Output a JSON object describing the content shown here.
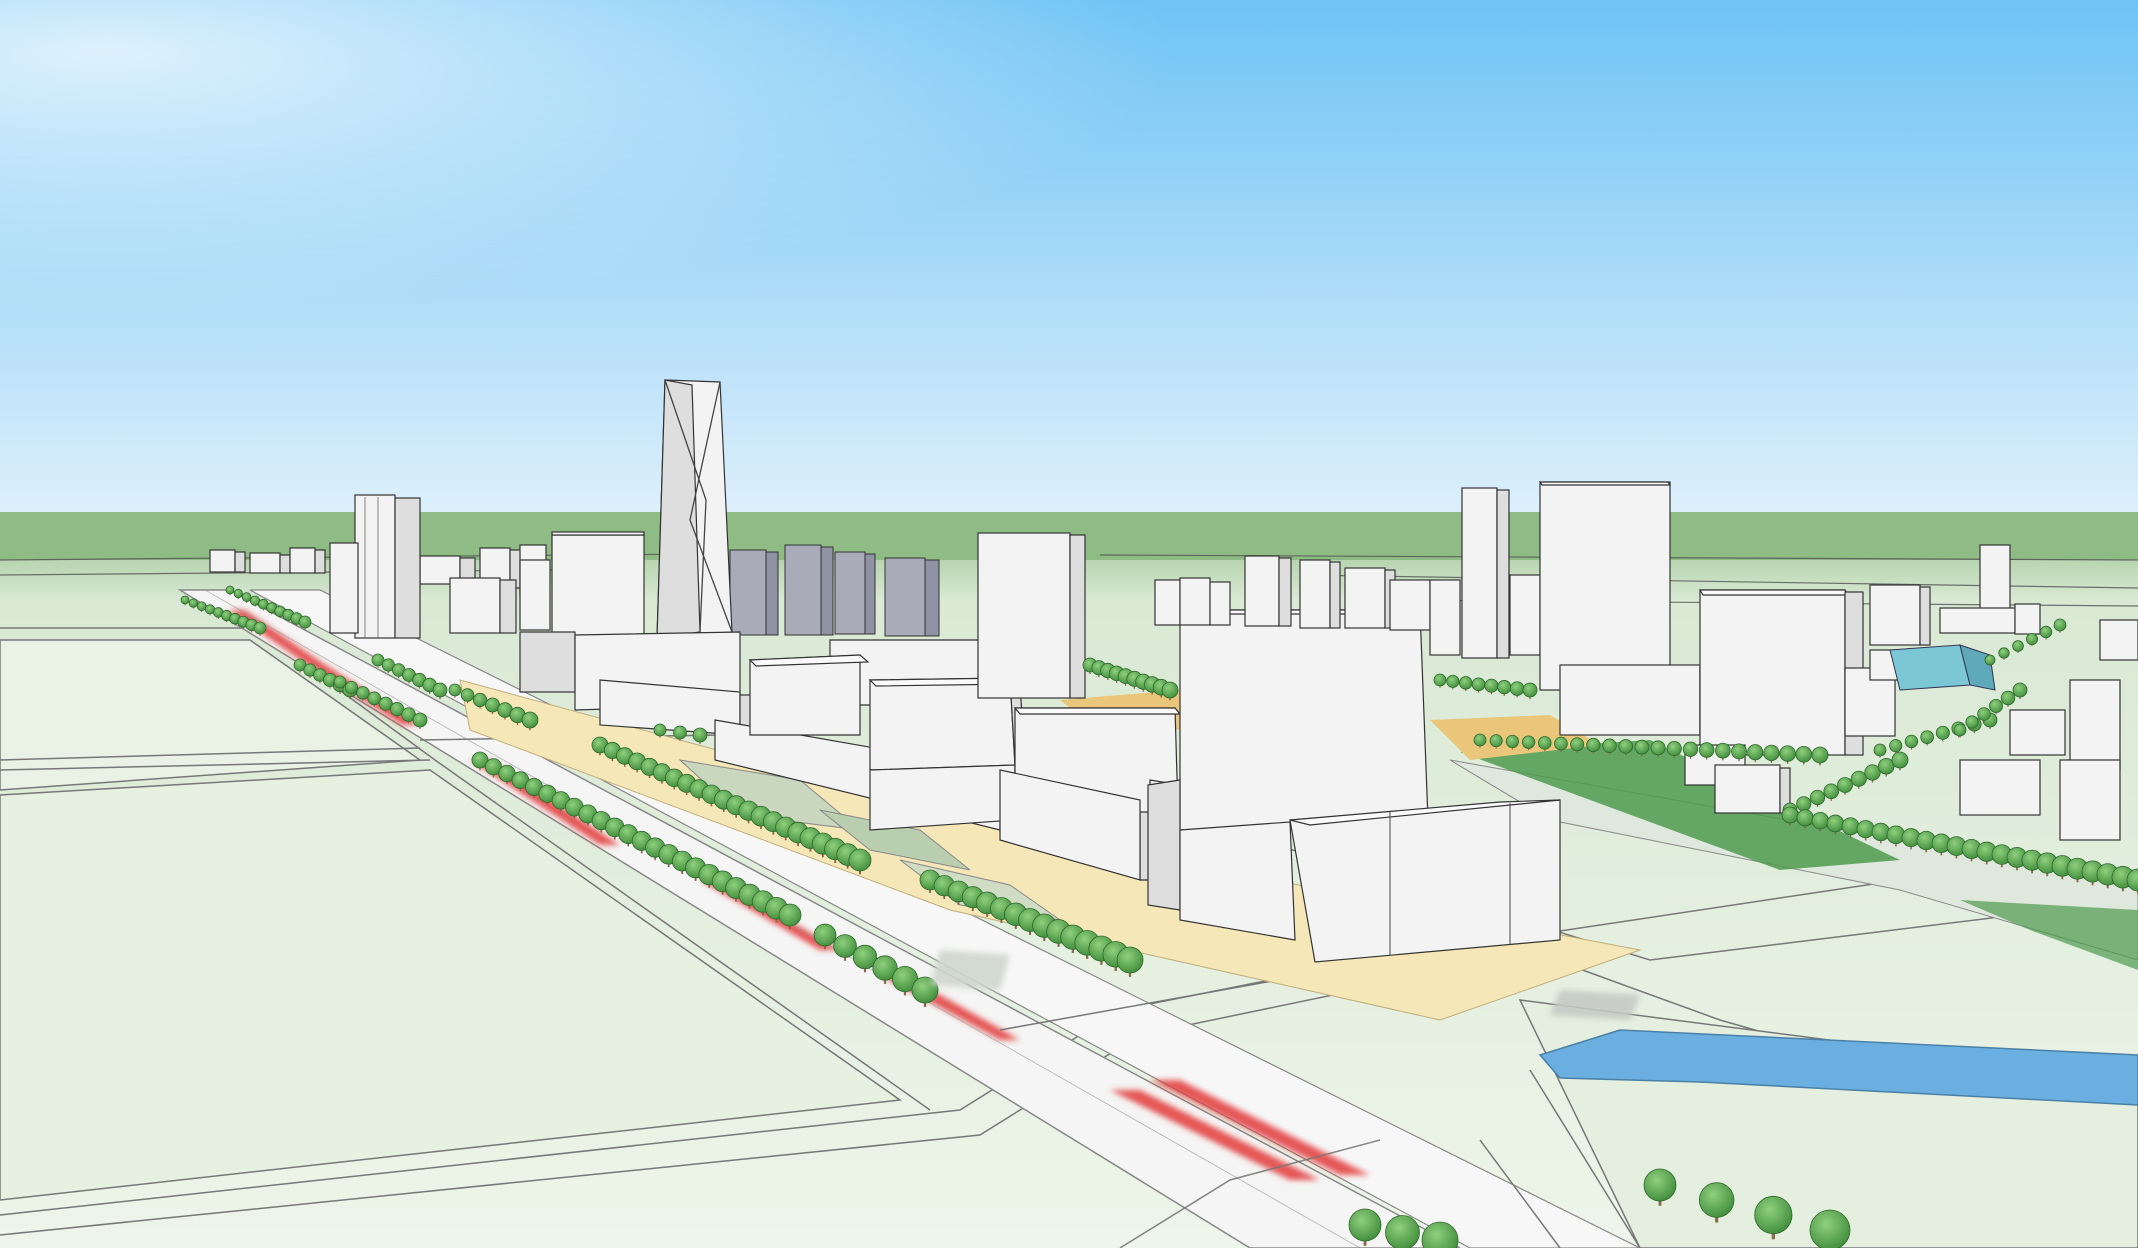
{
  "scene": {
    "kind": "3d-urban-massing-render",
    "colors": {
      "sky_top": "#6ec3f5",
      "sky_horizon": "#dff0fb",
      "ground_far": "#8fbc85",
      "ground_mid": "#d9e9d4",
      "ground_near": "#eef5ea",
      "road": "#f4f5f4",
      "road_edge": "#6f6f6f",
      "red_lane": "#e23a3a",
      "building_front": "#f3f3f3",
      "building_side": "#dedede",
      "building_top": "#fafafa",
      "building_outline": "#333333",
      "distant_blue_building": "#a9abb9",
      "plaza_yellow": "#f6e7b8",
      "plaza_orange": "#e9c67a",
      "lawn": "#4f9a4f",
      "tree_canopy": "#5fae55",
      "tree_trunk": "#8a6a4a",
      "water": "#6aafdf",
      "glass": "#7cc7d6"
    }
  }
}
